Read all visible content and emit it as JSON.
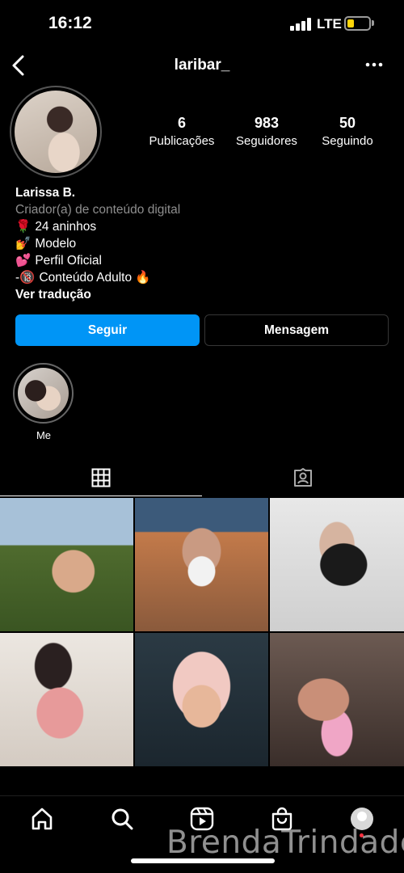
{
  "status_bar": {
    "time": "16:12",
    "network": "LTE",
    "battery_level": 0.3,
    "battery_color": "#ffd60a"
  },
  "header": {
    "username": "laribar_"
  },
  "stats": [
    {
      "value": "6",
      "label": "Publicações"
    },
    {
      "value": "983",
      "label": "Seguidores"
    },
    {
      "value": "50",
      "label": "Seguindo"
    }
  ],
  "bio": {
    "name": "Larissa B.",
    "category": "Criador(a) de conteúdo digital",
    "lines": [
      {
        "emoji": "🌹",
        "text": "24 aninhos"
      },
      {
        "emoji": "💅",
        "text": "Modelo"
      },
      {
        "emoji": "💕",
        "text": "Perfil Oficial"
      },
      {
        "prefix": "-",
        "emoji": "🔞",
        "text": "Conteúdo Adulto",
        "suffix": "🔥"
      }
    ],
    "translate": "Ver tradução"
  },
  "buttons": {
    "follow": "Seguir",
    "message": "Mensagem"
  },
  "colors": {
    "accent": "#0095f6",
    "muted_text": "#8e8e8e"
  },
  "highlights": [
    {
      "label": "Me"
    }
  ],
  "tabs": [
    {
      "icon": "grid-icon",
      "active": true
    },
    {
      "icon": "tagged-icon",
      "active": false
    }
  ],
  "posts_count": 6,
  "bottom_nav": [
    "home-icon",
    "search-icon",
    "reels-icon",
    "shop-icon",
    "profile-avatar"
  ],
  "watermark": "BrendaTrindade"
}
